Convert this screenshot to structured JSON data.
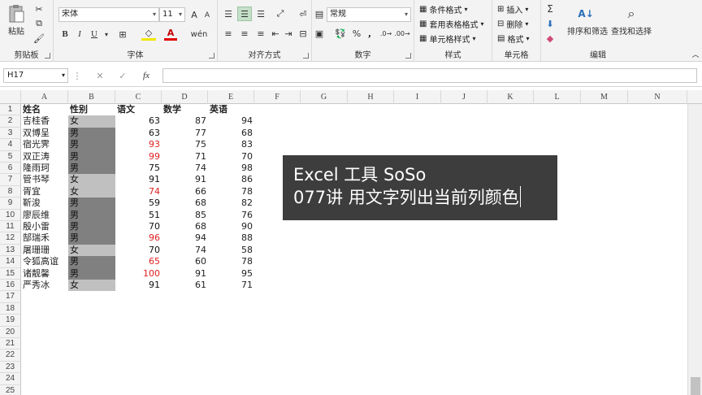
{
  "ribbon": {
    "clipboard": {
      "label": "剪贴板",
      "paste": "粘贴"
    },
    "font": {
      "label": "字体",
      "name": "宋体",
      "size": "11",
      "bold": "B",
      "italic": "I",
      "underline": "U"
    },
    "alignment": {
      "label": "对齐方式"
    },
    "number": {
      "label": "数字",
      "format": "常规",
      "percent": "%",
      "comma": ","
    },
    "styles": {
      "label": "样式",
      "conditional": "条件格式",
      "table": "套用表格格式",
      "cell": "单元格样式"
    },
    "cells": {
      "label": "单元格",
      "insert": "插入",
      "delete": "删除",
      "format": "格式"
    },
    "editing": {
      "label": "编辑",
      "sum": "Σ",
      "sort": "排序和筛选",
      "find": "查找和选择"
    }
  },
  "formula_bar": {
    "name_box": "H17",
    "fx": "fx",
    "value": ""
  },
  "columns": [
    "A",
    "B",
    "C",
    "D",
    "E",
    "F",
    "G",
    "H",
    "I",
    "J",
    "K",
    "L",
    "M",
    "N"
  ],
  "rows": [
    "1",
    "2",
    "3",
    "4",
    "5",
    "6",
    "7",
    "8",
    "9",
    "10",
    "11",
    "12",
    "13",
    "14",
    "15",
    "16",
    "17",
    "18",
    "19",
    "20",
    "21",
    "22",
    "23",
    "24",
    "25"
  ],
  "headers": [
    "姓名",
    "性别",
    "语文",
    "数学",
    "英语"
  ],
  "students": [
    {
      "name": "吉桂香",
      "gender": "女",
      "chinese": 63,
      "math": 87,
      "english": 94
    },
    {
      "name": "双博呈",
      "gender": "男",
      "chinese": 63,
      "math": 77,
      "english": 68
    },
    {
      "name": "宿光霁",
      "gender": "男",
      "chinese": 93,
      "math": 75,
      "english": 83
    },
    {
      "name": "双正涛",
      "gender": "男",
      "chinese": 99,
      "math": 71,
      "english": 70
    },
    {
      "name": "隆雨珂",
      "gender": "男",
      "chinese": 75,
      "math": 74,
      "english": 98
    },
    {
      "name": "管书琴",
      "gender": "女",
      "chinese": 91,
      "math": 91,
      "english": 86
    },
    {
      "name": "胥宜",
      "gender": "女",
      "chinese": 74,
      "math": 66,
      "english": 78
    },
    {
      "name": "靳浚",
      "gender": "男",
      "chinese": 59,
      "math": 68,
      "english": 82
    },
    {
      "name": "廖辰维",
      "gender": "男",
      "chinese": 51,
      "math": 85,
      "english": 76
    },
    {
      "name": "殷小雷",
      "gender": "男",
      "chinese": 70,
      "math": 68,
      "english": 90
    },
    {
      "name": "郜瑞禾",
      "gender": "男",
      "chinese": 96,
      "math": 94,
      "english": 88
    },
    {
      "name": "屠珊珊",
      "gender": "女",
      "chinese": 70,
      "math": 74,
      "english": 58
    },
    {
      "name": "令狐高谊",
      "gender": "男",
      "chinese": 65,
      "math": 60,
      "english": 78
    },
    {
      "name": "诸靓馨",
      "gender": "男",
      "chinese": 100,
      "math": 91,
      "english": 95
    },
    {
      "name": "严秀冰",
      "gender": "女",
      "chinese": 91,
      "math": 61,
      "english": 71
    }
  ],
  "colors": {
    "male_fill": "#808080",
    "female_fill": "#c0c0c0",
    "highlight_text": "#e02020",
    "normal_text": "#111111",
    "caption_bg": "#3d3d3d"
  },
  "caption": {
    "line1": "Excel 工具 SoSo",
    "line2": "077讲 用文字列出当前列颜色"
  }
}
